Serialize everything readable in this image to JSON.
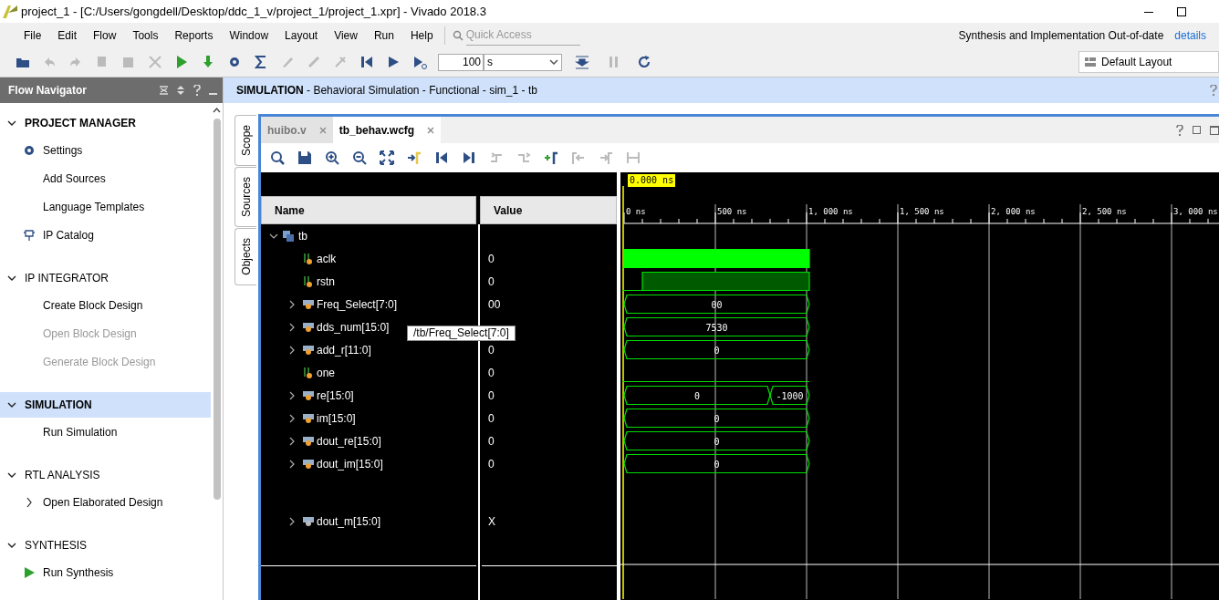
{
  "window": {
    "title": "project_1 - [C:/Users/gongdell/Desktop/ddc_1_v/project_1/project_1.xpr] - Vivado 2018.3"
  },
  "menu": [
    "File",
    "Edit",
    "Flow",
    "Tools",
    "Reports",
    "Window",
    "Layout",
    "View",
    "Run",
    "Help"
  ],
  "quick_access": {
    "placeholder": "Quick Access"
  },
  "status": {
    "text": "Synthesis and Implementation Out-of-date",
    "link": "details"
  },
  "toolbar": {
    "run_time": "100",
    "unit": "s"
  },
  "layout_select": "Default Layout",
  "navigator": {
    "title": "Flow Navigator",
    "sections": [
      {
        "title": "PROJECT MANAGER",
        "expanded": true,
        "selected": false,
        "items": [
          {
            "label": "Settings",
            "kind": "gear",
            "disabled": false
          },
          {
            "label": "Add Sources",
            "kind": "plain",
            "disabled": false
          },
          {
            "label": "Language Templates",
            "kind": "plain",
            "disabled": false
          },
          {
            "label": "IP Catalog",
            "kind": "ip",
            "disabled": false
          }
        ]
      },
      {
        "title": "IP INTEGRATOR",
        "expanded": true,
        "selected": false,
        "items": [
          {
            "label": "Create Block Design",
            "kind": "plain",
            "disabled": false
          },
          {
            "label": "Open Block Design",
            "kind": "plain",
            "disabled": true
          },
          {
            "label": "Generate Block Design",
            "kind": "plain",
            "disabled": true
          }
        ]
      },
      {
        "title": "SIMULATION",
        "expanded": true,
        "selected": true,
        "items": [
          {
            "label": "Run Simulation",
            "kind": "plain",
            "disabled": false
          }
        ]
      },
      {
        "title": "RTL ANALYSIS",
        "expanded": true,
        "selected": false,
        "items": [
          {
            "label": "Open Elaborated Design",
            "kind": "branch",
            "disabled": false
          }
        ]
      },
      {
        "title": "SYNTHESIS",
        "expanded": true,
        "selected": false,
        "items": [
          {
            "label": "Run Synthesis",
            "kind": "run",
            "disabled": false
          }
        ]
      }
    ]
  },
  "side_tabs": [
    "Scope",
    "Sources",
    "Objects"
  ],
  "sim_header": {
    "bold": "SIMULATION",
    "rest": " - Behavioral Simulation - Functional - sim_1 - tb"
  },
  "editor_tabs": [
    {
      "label": "huibo.v",
      "selected": false
    },
    {
      "label": "tb_behav.wcfg",
      "selected": true
    }
  ],
  "columns": [
    "Name",
    "Value"
  ],
  "cursor_time": "0.000 ns",
  "time_ticks": [
    "0 ns",
    "500 ns",
    "1, 000 ns",
    "1, 500 ns",
    "2, 000 ns",
    "2, 500 ns",
    "3, 000 ns"
  ],
  "tree": {
    "name": "tb",
    "expanded": true,
    "children": [
      {
        "name": "aclk",
        "kind": "clock",
        "value": "0"
      },
      {
        "name": "rstn",
        "kind": "step",
        "value": "0"
      },
      {
        "name": "Freq_Select[7:0]",
        "kind": "bus",
        "value": "00",
        "segments": [
          "00"
        ]
      },
      {
        "name": "dds_num[15:0]",
        "kind": "bus",
        "segments": [
          "7530"
        ]
      },
      {
        "name": "add_r[11:0]",
        "kind": "bus",
        "value": "0",
        "segments": [
          "0"
        ]
      },
      {
        "name": "one",
        "kind": "bit",
        "value": "0"
      },
      {
        "name": "re[15:0]",
        "kind": "bus",
        "value": "0",
        "segments": [
          "0",
          "-1000"
        ]
      },
      {
        "name": "im[15:0]",
        "kind": "bus",
        "value": "0",
        "segments": [
          "0"
        ]
      },
      {
        "name": "dout_re[15:0]",
        "kind": "bus",
        "value": "0",
        "segments": [
          "0"
        ]
      },
      {
        "name": "dout_im[15:0]",
        "kind": "bus",
        "value": "0",
        "segments": [
          "0"
        ]
      },
      {
        "name": "dout_m[15:0]",
        "kind": "bus",
        "value": "X",
        "gap_before": true
      }
    ]
  },
  "tooltip": "/tb/Freq_Select[7:0]"
}
